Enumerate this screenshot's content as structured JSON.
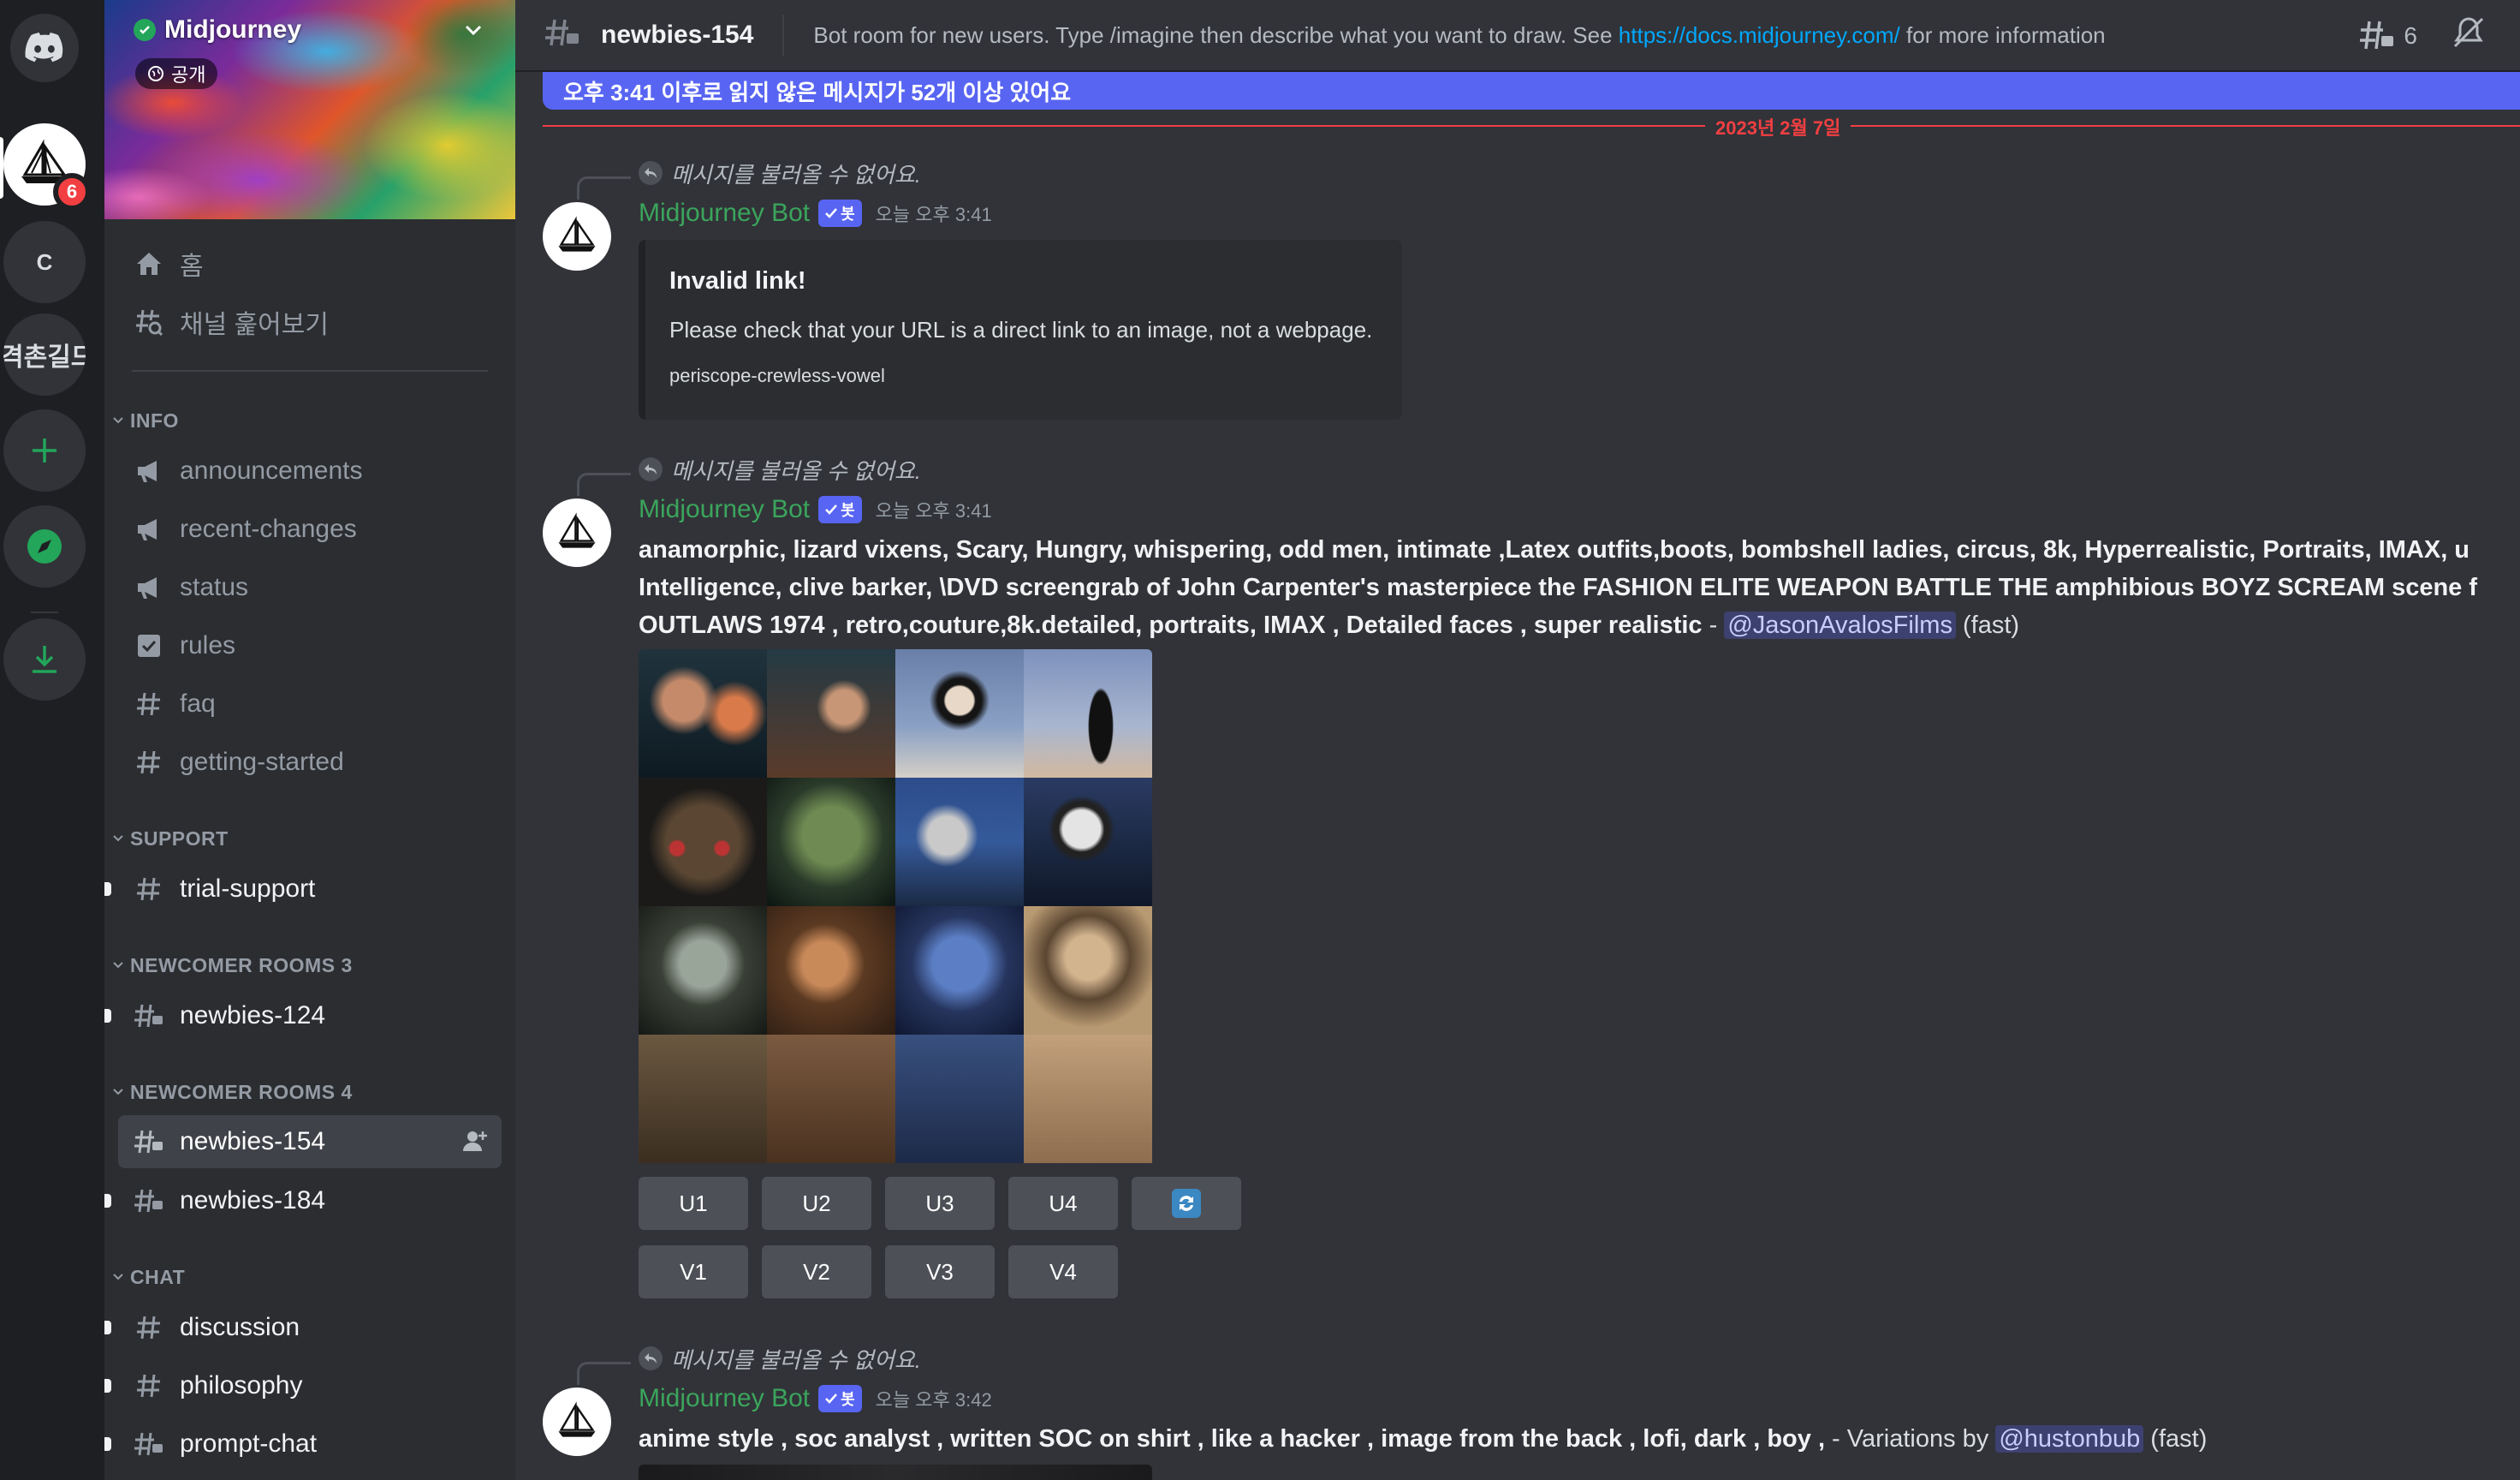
{
  "server": {
    "name": "Midjourney",
    "public_label": "공개",
    "badge_count": "6",
    "other_servers": [
      "C",
      "격촌길드"
    ]
  },
  "sidebar": {
    "home": "홈",
    "browse": "채널 훑어보기",
    "categories": {
      "info": "INFO",
      "support": "SUPPORT",
      "newcomer3": "NEWCOMER ROOMS 3",
      "newcomer4": "NEWCOMER ROOMS 4",
      "chat": "CHAT"
    },
    "channels": {
      "announcements": "announcements",
      "recent_changes": "recent-changes",
      "status": "status",
      "rules": "rules",
      "faq": "faq",
      "getting_started": "getting-started",
      "trial_support": "trial-support",
      "newbies_124": "newbies-124",
      "newbies_154": "newbies-154",
      "newbies_184": "newbies-184",
      "discussion": "discussion",
      "philosophy": "philosophy",
      "prompt_chat": "prompt-chat"
    }
  },
  "header": {
    "channel": "newbies-154",
    "topic_prefix": "Bot room for new users. Type /imagine then describe what you want to draw. See ",
    "topic_link": "https://docs.midjourney.com/",
    "topic_suffix": " for more information",
    "threads_count": "6"
  },
  "unread_bar": "오후 3:41 이후로 읽지 않은 메시지가 52개 이상 있어요",
  "date_divider": "2023년 2월 7일",
  "messages": [
    {
      "reply": "메시지를 불러올 수 없어요.",
      "author": "Midjourney Bot",
      "bot_tag": "봇",
      "time": "오늘 오후 3:41",
      "embed_title": "Invalid link!",
      "embed_desc": "Please check that your URL is a direct link to an image, not a webpage.",
      "embed_footer": "periscope-crewless-vowel"
    },
    {
      "reply": "메시지를 불러올 수 없어요.",
      "author": "Midjourney Bot",
      "bot_tag": "봇",
      "time": "오늘 오후 3:41",
      "line1": "anamorphic, lizard vixens, Scary, Hungry, whispering, odd men, intimate ,Latex outfits,boots, bombshell ladies, circus, 8k, Hyperrealistic, Portraits, IMAX, u",
      "line2": "Intelligence, clive barker, \\DVD screengrab of John Carpenter's masterpiece the FASHION ELITE WEAPON BATTLE THE amphibious BOYZ SCREAM scene f",
      "line3": "OUTLAWS 1974 , retro,couture,8k.detailed, portraits, IMAX , Detailed faces , super realistic",
      "dash": " - ",
      "mention": "@JasonAvalosFilms",
      "speed": " (fast)",
      "upscale_buttons": [
        "U1",
        "U2",
        "U3",
        "U4"
      ],
      "variation_buttons": [
        "V1",
        "V2",
        "V3",
        "V4"
      ]
    },
    {
      "reply": "메시지를 불러올 수 없어요.",
      "author": "Midjourney Bot",
      "bot_tag": "봇",
      "time": "오늘 오후 3:42",
      "text": "anime style , soc analyst , written SOC on shirt , like a hacker , image from the back , lofi, dark , boy ,",
      "variations_by": " - Variations by ",
      "mention": "@hustonbub",
      "speed": " (fast)"
    }
  ],
  "colors": {
    "accent": "#5865f2",
    "bot_name": "#3ba55c",
    "new_divider": "#f23f42",
    "link": "#00a8fc"
  }
}
